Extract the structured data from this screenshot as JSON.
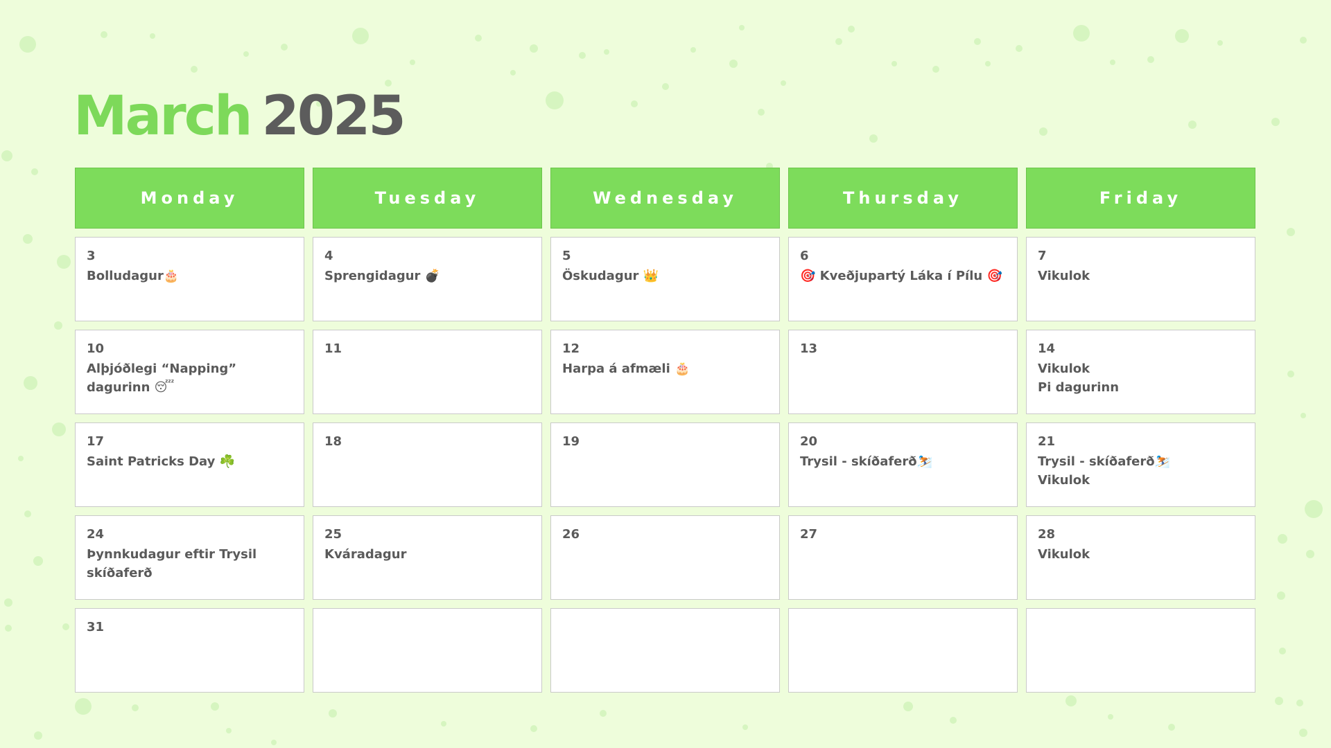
{
  "title": {
    "month": "March",
    "year": "2025"
  },
  "colors": {
    "background": "#eefddb",
    "accent": "#7ddc5b",
    "year": "#5c5c5c",
    "text": "#5a5a5a"
  },
  "weekdays": [
    "Monday",
    "Tuesday",
    "Wednesday",
    "Thursday",
    "Friday"
  ],
  "weeks": [
    [
      {
        "day": "3",
        "events": [
          "Bolludagur🎂"
        ]
      },
      {
        "day": "4",
        "events": [
          "Sprengidagur 💣"
        ]
      },
      {
        "day": "5",
        "events": [
          "Öskudagur 👑"
        ]
      },
      {
        "day": "6",
        "events": [
          "🎯 Kveðjupartý Láka í Pílu 🎯"
        ]
      },
      {
        "day": "7",
        "events": [
          "Vikulok"
        ]
      }
    ],
    [
      {
        "day": "10",
        "events": [
          "Alþjóðlegi “Napping” dagurinn 😴"
        ]
      },
      {
        "day": "11",
        "events": []
      },
      {
        "day": "12",
        "events": [
          "Harpa á afmæli 🎂"
        ]
      },
      {
        "day": "13",
        "events": []
      },
      {
        "day": "14",
        "events": [
          "Vikulok",
          "Pi dagurinn"
        ]
      }
    ],
    [
      {
        "day": "17",
        "events": [
          "Saint Patricks Day ☘️"
        ]
      },
      {
        "day": "18",
        "events": []
      },
      {
        "day": "19",
        "events": []
      },
      {
        "day": "20",
        "events": [
          "Trysil - skíðaferð⛷️"
        ]
      },
      {
        "day": "21",
        "events": [
          "Trysil - skíðaferð⛷️",
          "Vikulok"
        ]
      }
    ],
    [
      {
        "day": "24",
        "events": [
          "Þynnkudagur eftir Trysil skíðaferð"
        ]
      },
      {
        "day": "25",
        "events": [
          "Kváradagur"
        ]
      },
      {
        "day": "26",
        "events": []
      },
      {
        "day": "27",
        "events": []
      },
      {
        "day": "28",
        "events": [
          "Vikulok"
        ]
      }
    ],
    [
      {
        "day": "31",
        "events": []
      },
      {
        "day": "",
        "events": []
      },
      {
        "day": "",
        "events": []
      },
      {
        "day": "",
        "events": []
      },
      {
        "day": "",
        "events": []
      }
    ]
  ]
}
